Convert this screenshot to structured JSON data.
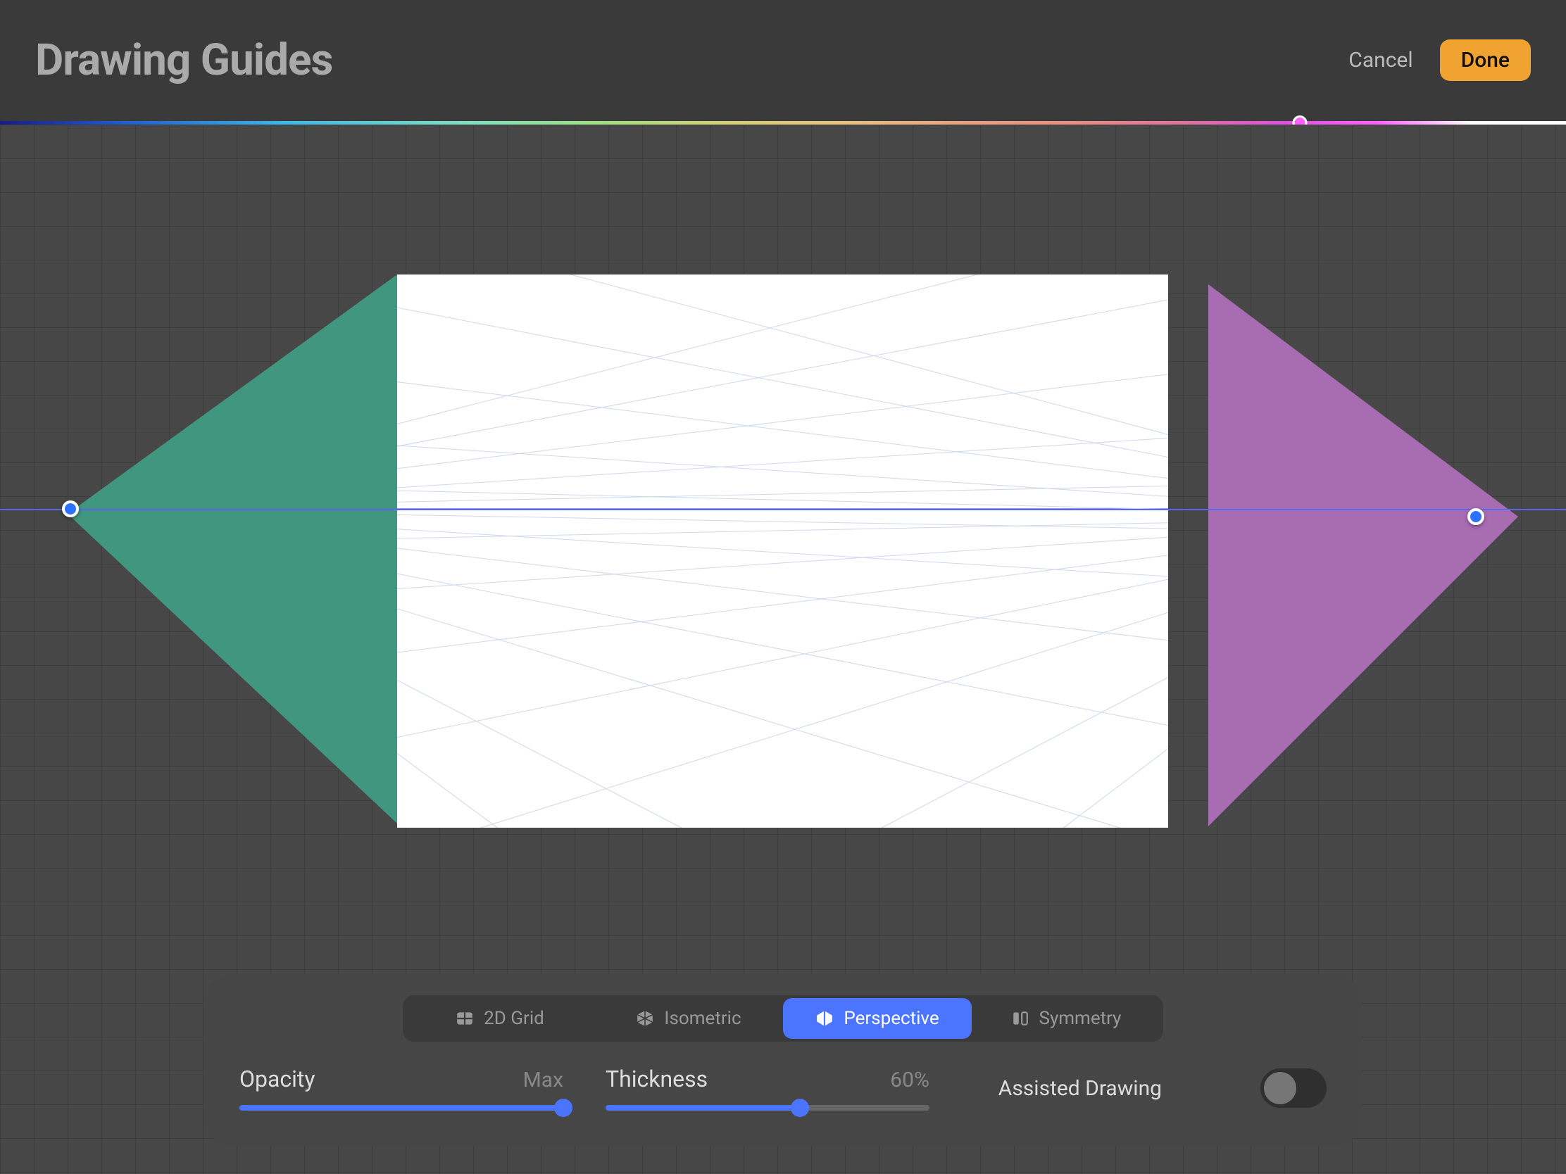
{
  "header": {
    "title": "Drawing Guides",
    "cancel_label": "Cancel",
    "done_label": "Done"
  },
  "color_picker": {
    "position_percent": 83,
    "selected_color": "#ff60ff"
  },
  "guide_tabs": [
    {
      "label": "2D Grid",
      "icon": "grid-icon",
      "active": false
    },
    {
      "label": "Isometric",
      "icon": "cube-icon",
      "active": false
    },
    {
      "label": "Perspective",
      "icon": "hexagon-icon",
      "active": true
    },
    {
      "label": "Symmetry",
      "icon": "mirror-icon",
      "active": false
    }
  ],
  "sliders": {
    "opacity": {
      "label": "Opacity",
      "value_text": "Max",
      "percent": 100
    },
    "thickness": {
      "label": "Thickness",
      "value_text": "60%",
      "percent": 60
    }
  },
  "toggle": {
    "label": "Assisted Drawing",
    "on": false
  },
  "perspective": {
    "horizon_y_ratio": 0.424,
    "vp_left_color": "#419680",
    "vp_right_color": "#a86cb3"
  }
}
